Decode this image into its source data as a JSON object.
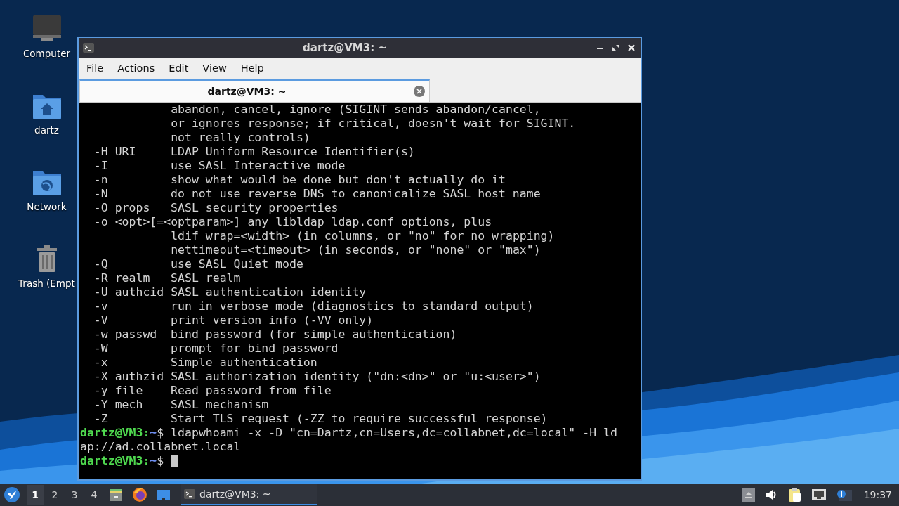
{
  "desktop_icons": [
    {
      "kind": "computer",
      "label": "Computer"
    },
    {
      "kind": "home",
      "label": "dartz"
    },
    {
      "kind": "network",
      "label": "Network"
    },
    {
      "kind": "trash",
      "label": "Trash (Empt"
    }
  ],
  "window": {
    "title": "dartz@VM3: ~",
    "menu": [
      "File",
      "Actions",
      "Edit",
      "View",
      "Help"
    ],
    "tabs": [
      {
        "label": "dartz@VM3: ~",
        "selected": true
      }
    ],
    "terminal": {
      "lines": [
        {
          "kind": "continuation",
          "text": "abandon, cancel, ignore (SIGINT sends abandon/cancel,"
        },
        {
          "kind": "continuation",
          "text": "or ignores response; if critical, doesn't wait for SIGINT."
        },
        {
          "kind": "continuation",
          "text": "not really controls)"
        },
        {
          "kind": "option",
          "flag": "-H URI",
          "text": "LDAP Uniform Resource Identifier(s)"
        },
        {
          "kind": "option",
          "flag": "-I",
          "text": "use SASL Interactive mode"
        },
        {
          "kind": "option",
          "flag": "-n",
          "text": "show what would be done but don't actually do it"
        },
        {
          "kind": "option",
          "flag": "-N",
          "text": "do not use reverse DNS to canonicalize SASL host name"
        },
        {
          "kind": "option",
          "flag": "-O props",
          "text": "SASL security properties"
        },
        {
          "kind": "option",
          "flag": "-o <opt>[=<optparam>]",
          "text": "any libldap ldap.conf options, plus"
        },
        {
          "kind": "continuation",
          "text": "ldif_wrap=<width> (in columns, or \"no\" for no wrapping)"
        },
        {
          "kind": "continuation",
          "text": "nettimeout=<timeout> (in seconds, or \"none\" or \"max\")"
        },
        {
          "kind": "option",
          "flag": "-Q",
          "text": "use SASL Quiet mode"
        },
        {
          "kind": "option",
          "flag": "-R realm",
          "text": "SASL realm"
        },
        {
          "kind": "option",
          "flag": "-U authcid",
          "text": "SASL authentication identity"
        },
        {
          "kind": "option",
          "flag": "-v",
          "text": "run in verbose mode (diagnostics to standard output)"
        },
        {
          "kind": "option",
          "flag": "-V",
          "text": "print version info (-VV only)"
        },
        {
          "kind": "option",
          "flag": "-w passwd",
          "text": "bind password (for simple authentication)"
        },
        {
          "kind": "option",
          "flag": "-W",
          "text": "prompt for bind password"
        },
        {
          "kind": "option",
          "flag": "-x",
          "text": "Simple authentication"
        },
        {
          "kind": "option",
          "flag": "-X authzid",
          "text": "SASL authorization identity (\"dn:<dn>\" or \"u:<user>\")"
        },
        {
          "kind": "option",
          "flag": "-y file",
          "text": "Read password from file"
        },
        {
          "kind": "option",
          "flag": "-Y mech",
          "text": "SASL mechanism"
        },
        {
          "kind": "option",
          "flag": "-Z",
          "text": "Start TLS request (-ZZ to require successful response)"
        },
        {
          "kind": "prompt",
          "user": "dartz@VM3:",
          "path": "~",
          "symbol": "$",
          "command": "ldapwhoami -x -D \"cn=Dartz,cn=Users,dc=collabnet,dc=local\" -H ld",
          "cursor": false
        },
        {
          "kind": "output",
          "text": "ap://ad.collabnet.local"
        },
        {
          "kind": "prompt",
          "user": "dartz@VM3:",
          "path": "~",
          "symbol": "$",
          "cursor": true
        }
      ]
    }
  },
  "taskbar": {
    "workspaces": [
      {
        "label": "1",
        "selected": true
      },
      {
        "label": "2",
        "selected": false
      },
      {
        "label": "3",
        "selected": false
      },
      {
        "label": "4",
        "selected": false
      }
    ],
    "tasks": [
      {
        "label": "dartz@VM3: ~",
        "selected": true
      }
    ],
    "clock": "19:37"
  }
}
